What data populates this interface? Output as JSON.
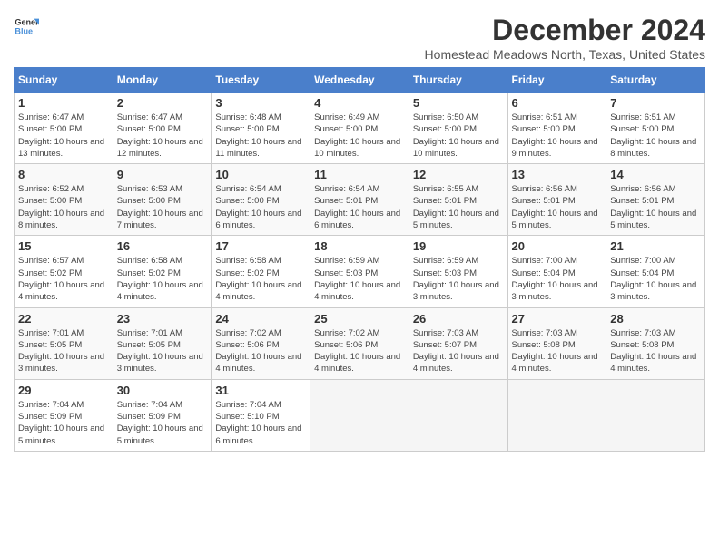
{
  "logo": {
    "line1": "General",
    "line2": "Blue"
  },
  "title": "December 2024",
  "location": "Homestead Meadows North, Texas, United States",
  "days_of_week": [
    "Sunday",
    "Monday",
    "Tuesday",
    "Wednesday",
    "Thursday",
    "Friday",
    "Saturday"
  ],
  "weeks": [
    [
      {
        "day": "1",
        "info": "Sunrise: 6:47 AM\nSunset: 5:00 PM\nDaylight: 10 hours and 13 minutes."
      },
      {
        "day": "2",
        "info": "Sunrise: 6:47 AM\nSunset: 5:00 PM\nDaylight: 10 hours and 12 minutes."
      },
      {
        "day": "3",
        "info": "Sunrise: 6:48 AM\nSunset: 5:00 PM\nDaylight: 10 hours and 11 minutes."
      },
      {
        "day": "4",
        "info": "Sunrise: 6:49 AM\nSunset: 5:00 PM\nDaylight: 10 hours and 10 minutes."
      },
      {
        "day": "5",
        "info": "Sunrise: 6:50 AM\nSunset: 5:00 PM\nDaylight: 10 hours and 10 minutes."
      },
      {
        "day": "6",
        "info": "Sunrise: 6:51 AM\nSunset: 5:00 PM\nDaylight: 10 hours and 9 minutes."
      },
      {
        "day": "7",
        "info": "Sunrise: 6:51 AM\nSunset: 5:00 PM\nDaylight: 10 hours and 8 minutes."
      }
    ],
    [
      {
        "day": "8",
        "info": "Sunrise: 6:52 AM\nSunset: 5:00 PM\nDaylight: 10 hours and 8 minutes."
      },
      {
        "day": "9",
        "info": "Sunrise: 6:53 AM\nSunset: 5:00 PM\nDaylight: 10 hours and 7 minutes."
      },
      {
        "day": "10",
        "info": "Sunrise: 6:54 AM\nSunset: 5:00 PM\nDaylight: 10 hours and 6 minutes."
      },
      {
        "day": "11",
        "info": "Sunrise: 6:54 AM\nSunset: 5:01 PM\nDaylight: 10 hours and 6 minutes."
      },
      {
        "day": "12",
        "info": "Sunrise: 6:55 AM\nSunset: 5:01 PM\nDaylight: 10 hours and 5 minutes."
      },
      {
        "day": "13",
        "info": "Sunrise: 6:56 AM\nSunset: 5:01 PM\nDaylight: 10 hours and 5 minutes."
      },
      {
        "day": "14",
        "info": "Sunrise: 6:56 AM\nSunset: 5:01 PM\nDaylight: 10 hours and 5 minutes."
      }
    ],
    [
      {
        "day": "15",
        "info": "Sunrise: 6:57 AM\nSunset: 5:02 PM\nDaylight: 10 hours and 4 minutes."
      },
      {
        "day": "16",
        "info": "Sunrise: 6:58 AM\nSunset: 5:02 PM\nDaylight: 10 hours and 4 minutes."
      },
      {
        "day": "17",
        "info": "Sunrise: 6:58 AM\nSunset: 5:02 PM\nDaylight: 10 hours and 4 minutes."
      },
      {
        "day": "18",
        "info": "Sunrise: 6:59 AM\nSunset: 5:03 PM\nDaylight: 10 hours and 4 minutes."
      },
      {
        "day": "19",
        "info": "Sunrise: 6:59 AM\nSunset: 5:03 PM\nDaylight: 10 hours and 3 minutes."
      },
      {
        "day": "20",
        "info": "Sunrise: 7:00 AM\nSunset: 5:04 PM\nDaylight: 10 hours and 3 minutes."
      },
      {
        "day": "21",
        "info": "Sunrise: 7:00 AM\nSunset: 5:04 PM\nDaylight: 10 hours and 3 minutes."
      }
    ],
    [
      {
        "day": "22",
        "info": "Sunrise: 7:01 AM\nSunset: 5:05 PM\nDaylight: 10 hours and 3 minutes."
      },
      {
        "day": "23",
        "info": "Sunrise: 7:01 AM\nSunset: 5:05 PM\nDaylight: 10 hours and 3 minutes."
      },
      {
        "day": "24",
        "info": "Sunrise: 7:02 AM\nSunset: 5:06 PM\nDaylight: 10 hours and 4 minutes."
      },
      {
        "day": "25",
        "info": "Sunrise: 7:02 AM\nSunset: 5:06 PM\nDaylight: 10 hours and 4 minutes."
      },
      {
        "day": "26",
        "info": "Sunrise: 7:03 AM\nSunset: 5:07 PM\nDaylight: 10 hours and 4 minutes."
      },
      {
        "day": "27",
        "info": "Sunrise: 7:03 AM\nSunset: 5:08 PM\nDaylight: 10 hours and 4 minutes."
      },
      {
        "day": "28",
        "info": "Sunrise: 7:03 AM\nSunset: 5:08 PM\nDaylight: 10 hours and 4 minutes."
      }
    ],
    [
      {
        "day": "29",
        "info": "Sunrise: 7:04 AM\nSunset: 5:09 PM\nDaylight: 10 hours and 5 minutes."
      },
      {
        "day": "30",
        "info": "Sunrise: 7:04 AM\nSunset: 5:09 PM\nDaylight: 10 hours and 5 minutes."
      },
      {
        "day": "31",
        "info": "Sunrise: 7:04 AM\nSunset: 5:10 PM\nDaylight: 10 hours and 6 minutes."
      },
      null,
      null,
      null,
      null
    ]
  ]
}
